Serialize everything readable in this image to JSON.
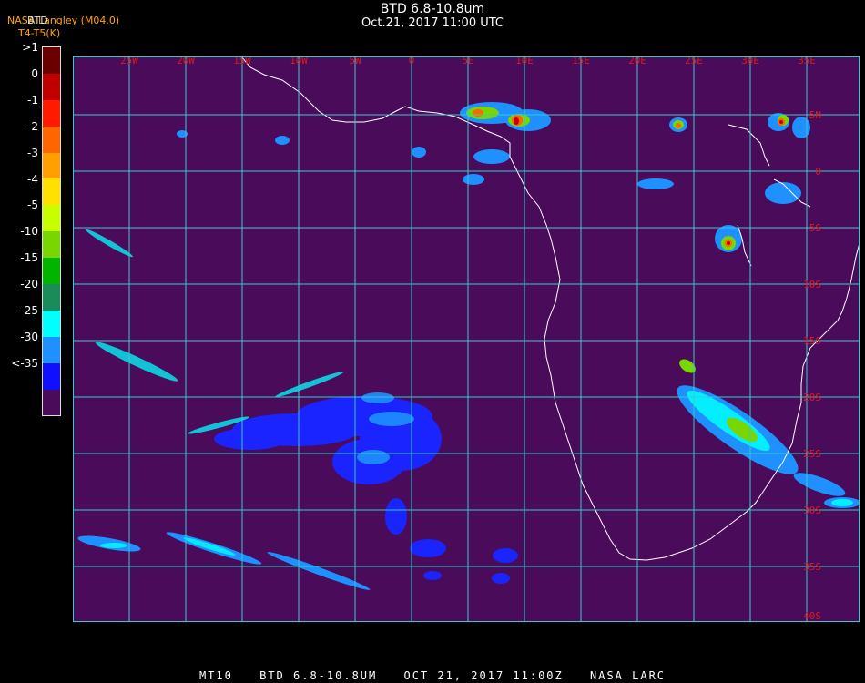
{
  "title": "BTD 6.8-10.8um",
  "subtitle": "Oct.21, 2017 11:00 UTC",
  "credit": "NASA Langley (M04.0)",
  "credit_overlay": "BTD",
  "units": "T4-T5(K)",
  "legend": {
    "labels": [
      ">1",
      "0",
      "-1",
      "-2",
      "-3",
      "-4",
      "-5",
      "-10",
      "-15",
      "-20",
      "-25",
      "-30",
      "<-35"
    ],
    "colors": [
      "#6b0000",
      "#c00000",
      "#ff1a00",
      "#ff6600",
      "#ffa000",
      "#ffe000",
      "#c8ff00",
      "#7ad600",
      "#00b400",
      "#1a8c5a",
      "#00ffff",
      "#1e90ff",
      "#1010ff",
      "#4a0b5a"
    ]
  },
  "map": {
    "background": "#4a0b5a",
    "grid_color": "#33cccc",
    "coast_color": "#ffffff",
    "lon_labels": [
      "25W",
      "20W",
      "15W",
      "10W",
      "5W",
      "0",
      "5E",
      "10E",
      "15E",
      "20E",
      "25E",
      "30E",
      "35E"
    ],
    "lat_labels": [
      "5N",
      "0",
      "5S",
      "10S",
      "15S",
      "20S",
      "25S",
      "30S",
      "35S",
      "40S"
    ]
  },
  "footer": {
    "satellite": "MT10",
    "product": "BTD 6.8-10.8UM",
    "datetime": "OCT 21, 2017 11:00Z",
    "source": "NASA LARC"
  }
}
